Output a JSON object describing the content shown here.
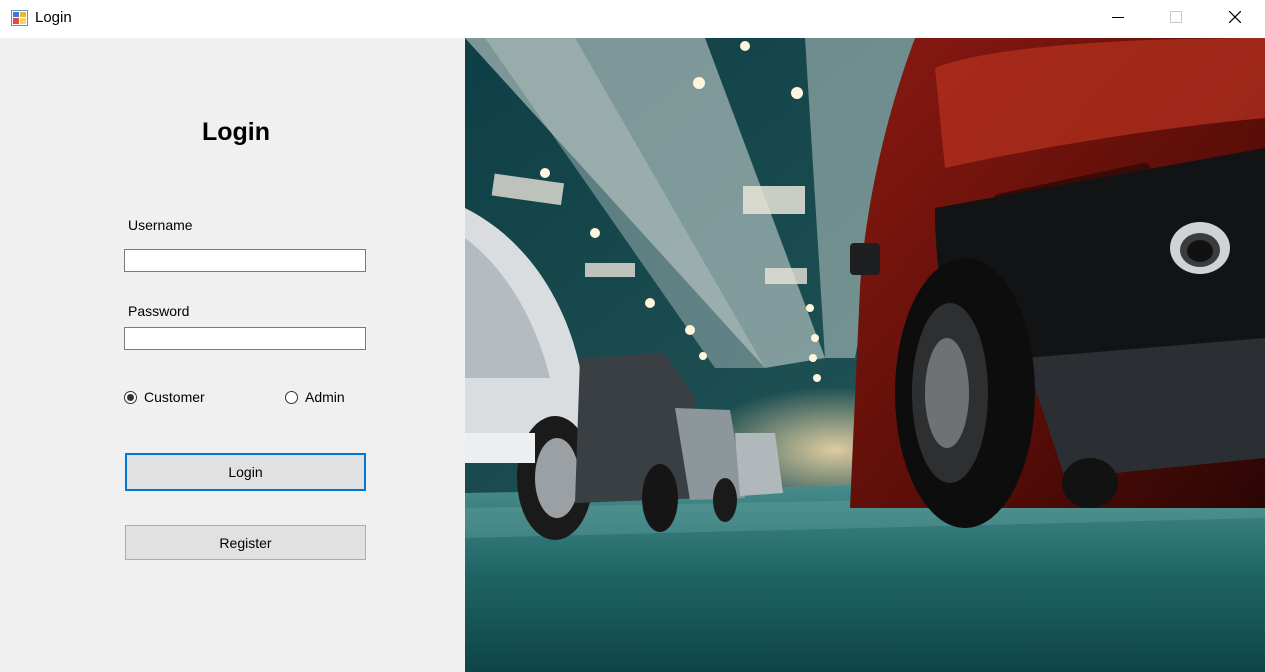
{
  "window": {
    "title": "Login",
    "controls": {
      "minimize_icon": "minimize-icon",
      "maximize_icon": "maximize-icon",
      "close_icon": "close-icon"
    }
  },
  "form": {
    "heading": "Login",
    "username": {
      "label": "Username",
      "value": "",
      "placeholder": ""
    },
    "password": {
      "label": "Password",
      "value": "",
      "placeholder": ""
    },
    "roles": [
      {
        "label": "Customer",
        "checked": true
      },
      {
        "label": "Admin",
        "checked": false
      }
    ],
    "login_button": "Login",
    "register_button": "Register"
  },
  "colors": {
    "panel_bg": "#f0f0f0",
    "focus_accent": "#0078d7",
    "button_bg": "#e1e1e1"
  },
  "image": {
    "subject": "car-showroom-photo"
  }
}
